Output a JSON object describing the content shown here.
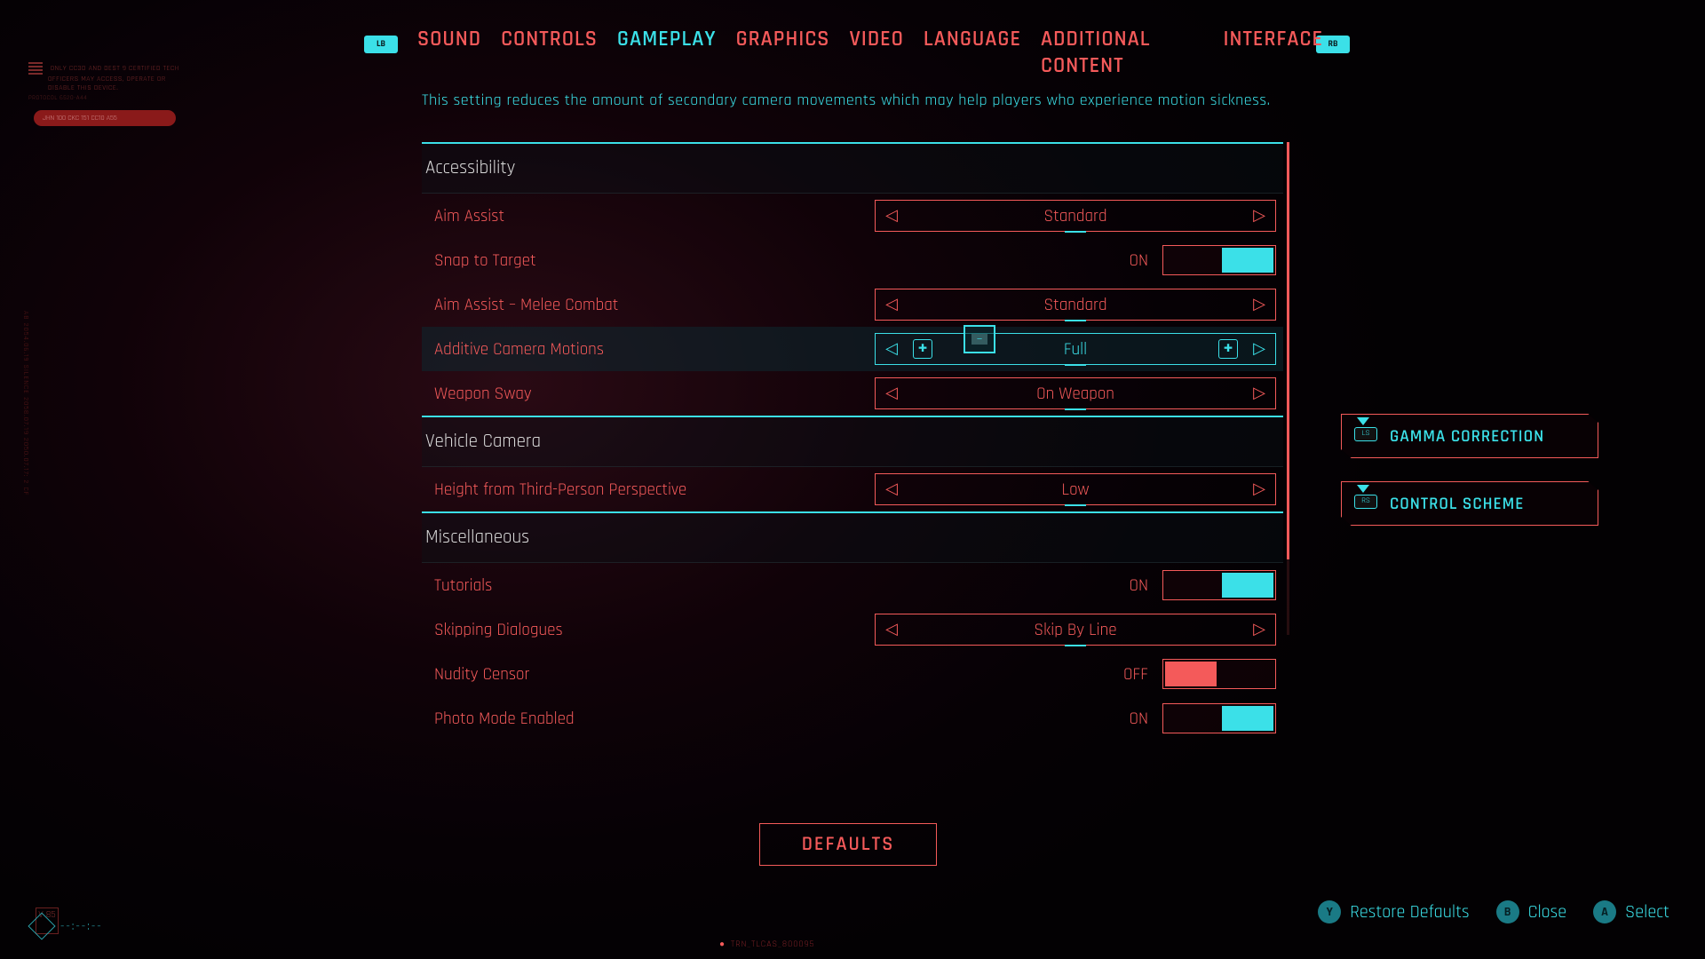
{
  "shoulders": {
    "left": "LB",
    "right": "RB"
  },
  "topnav": {
    "items": [
      "SOUND",
      "CONTROLS",
      "GAMEPLAY",
      "GRAPHICS",
      "VIDEO",
      "LANGUAGE",
      "ADDITIONAL CONTENT",
      "INTERFACE"
    ],
    "active_index": 2
  },
  "description": "This setting reduces the amount of secondary camera movements which may help players who experience motion sickness.",
  "sections": {
    "accessibility": {
      "title": "Accessibility",
      "rows": {
        "aim_assist": {
          "label": "Aim Assist",
          "control": "selector",
          "value": "Standard"
        },
        "snap_target": {
          "label": "Snap to Target",
          "control": "toggle",
          "state": "ON"
        },
        "aim_melee": {
          "label": "Aim Assist – Melee Combat",
          "control": "selector",
          "value": "Standard"
        },
        "additive_cam": {
          "label": "Additive Camera Motions",
          "control": "selector",
          "value": "Full",
          "highlight": true
        },
        "weapon_sway": {
          "label": "Weapon Sway",
          "control": "selector",
          "value": "On Weapon"
        }
      }
    },
    "vehicle": {
      "title": "Vehicle Camera",
      "rows": {
        "height_tp": {
          "label": "Height from Third-Person Perspective",
          "control": "selector",
          "value": "Low"
        }
      }
    },
    "misc": {
      "title": "Miscellaneous",
      "rows": {
        "tutorials": {
          "label": "Tutorials",
          "control": "toggle",
          "state": "ON"
        },
        "skipping": {
          "label": "Skipping Dialogues",
          "control": "selector",
          "value": "Skip By Line"
        },
        "nudity": {
          "label": "Nudity Censor",
          "control": "toggle",
          "state": "OFF"
        },
        "photo": {
          "label": "Photo Mode Enabled",
          "control": "toggle",
          "state": "ON"
        }
      }
    }
  },
  "side_buttons": {
    "gamma": {
      "stick": "LS",
      "label": "GAMMA CORRECTION"
    },
    "control": {
      "stick": "RS",
      "label": "CONTROL SCHEME"
    }
  },
  "defaults_label": "DEFAULTS",
  "hints": {
    "y": {
      "glyph": "Y",
      "label": "Restore Defaults"
    },
    "b": {
      "glyph": "B",
      "label": "Close"
    },
    "a": {
      "glyph": "A",
      "label": "Select"
    }
  },
  "deco": {
    "tl_line1": "ONLY CC3D AND DEST 9 CERTIFIED TECH",
    "tl_line2": "OFFICERS MAY ACCESS, OPERATE OR",
    "tl_line3": "DISABLE THIS DEVICE.",
    "tl_proto": "PROTOCOL 6520-A44",
    "badge": "JHN 100 CKC 151 CC10 A55",
    "bottom_code": "TRN_TLCAS_800095",
    "v_label": "V\n85",
    "side_text": "AB 2054.06.19 SILENCE 2058.07.19 2050.07.17: 2 CF"
  }
}
